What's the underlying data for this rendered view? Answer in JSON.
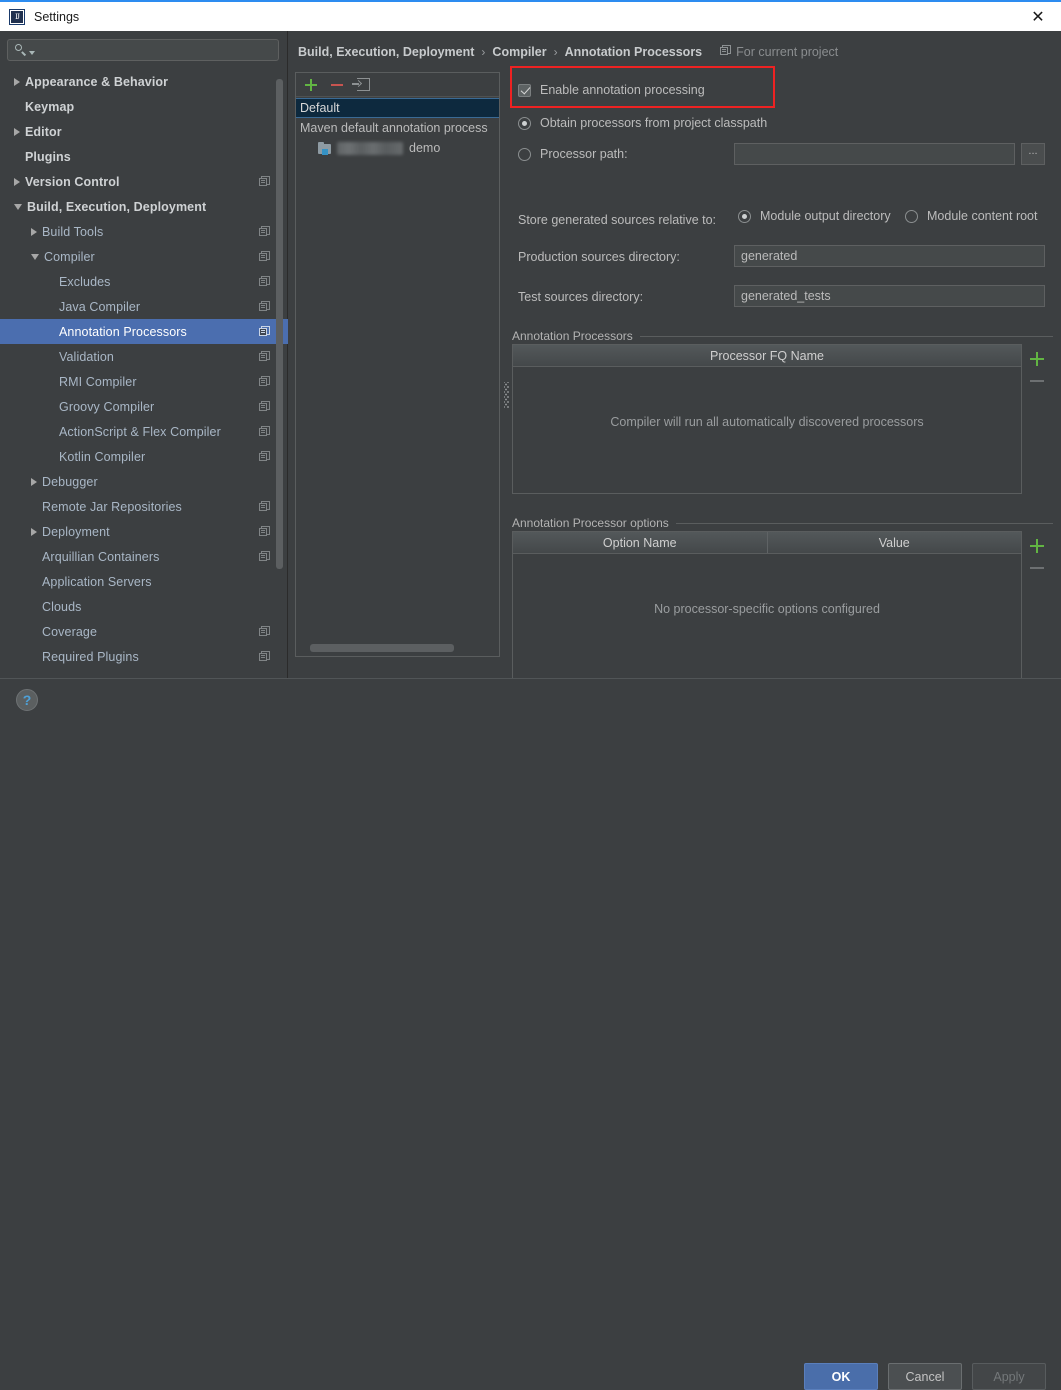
{
  "window": {
    "title": "Settings",
    "app_icon": "intellij-idea-icon",
    "close_label": "✕"
  },
  "sidebar": {
    "search": {
      "placeholder": "",
      "value": "",
      "icon": "search-icon"
    },
    "items": [
      {
        "label": "Appearance & Behavior",
        "indent": 0,
        "arrow": "collapsed",
        "bold": true,
        "project_icon": false,
        "selected": false
      },
      {
        "label": "Keymap",
        "indent": 0,
        "arrow": "none",
        "bold": true,
        "project_icon": false,
        "selected": false
      },
      {
        "label": "Editor",
        "indent": 0,
        "arrow": "collapsed",
        "bold": true,
        "project_icon": false,
        "selected": false
      },
      {
        "label": "Plugins",
        "indent": 0,
        "arrow": "none",
        "bold": true,
        "project_icon": false,
        "selected": false
      },
      {
        "label": "Version Control",
        "indent": 0,
        "arrow": "collapsed",
        "bold": true,
        "project_icon": true,
        "selected": false
      },
      {
        "label": "Build, Execution, Deployment",
        "indent": 0,
        "arrow": "expanded",
        "bold": true,
        "project_icon": false,
        "selected": false
      },
      {
        "label": "Build Tools",
        "indent": 1,
        "arrow": "collapsed",
        "bold": false,
        "project_icon": true,
        "selected": false
      },
      {
        "label": "Compiler",
        "indent": 1,
        "arrow": "expanded",
        "bold": false,
        "project_icon": true,
        "selected": false
      },
      {
        "label": "Excludes",
        "indent": 2,
        "arrow": "none",
        "bold": false,
        "project_icon": true,
        "selected": false
      },
      {
        "label": "Java Compiler",
        "indent": 2,
        "arrow": "none",
        "bold": false,
        "project_icon": true,
        "selected": false
      },
      {
        "label": "Annotation Processors",
        "indent": 2,
        "arrow": "none",
        "bold": false,
        "project_icon": true,
        "selected": true
      },
      {
        "label": "Validation",
        "indent": 2,
        "arrow": "none",
        "bold": false,
        "project_icon": true,
        "selected": false
      },
      {
        "label": "RMI Compiler",
        "indent": 2,
        "arrow": "none",
        "bold": false,
        "project_icon": true,
        "selected": false
      },
      {
        "label": "Groovy Compiler",
        "indent": 2,
        "arrow": "none",
        "bold": false,
        "project_icon": true,
        "selected": false
      },
      {
        "label": "ActionScript & Flex Compiler",
        "indent": 2,
        "arrow": "none",
        "bold": false,
        "project_icon": true,
        "selected": false
      },
      {
        "label": "Kotlin Compiler",
        "indent": 2,
        "arrow": "none",
        "bold": false,
        "project_icon": true,
        "selected": false
      },
      {
        "label": "Debugger",
        "indent": 1,
        "arrow": "collapsed",
        "bold": false,
        "project_icon": false,
        "selected": false
      },
      {
        "label": "Remote Jar Repositories",
        "indent": 1,
        "arrow": "none",
        "bold": false,
        "project_icon": true,
        "selected": false
      },
      {
        "label": "Deployment",
        "indent": 1,
        "arrow": "collapsed",
        "bold": false,
        "project_icon": true,
        "selected": false
      },
      {
        "label": "Arquillian Containers",
        "indent": 1,
        "arrow": "none",
        "bold": false,
        "project_icon": true,
        "selected": false
      },
      {
        "label": "Application Servers",
        "indent": 1,
        "arrow": "none",
        "bold": false,
        "project_icon": false,
        "selected": false
      },
      {
        "label": "Clouds",
        "indent": 1,
        "arrow": "none",
        "bold": false,
        "project_icon": false,
        "selected": false
      },
      {
        "label": "Coverage",
        "indent": 1,
        "arrow": "none",
        "bold": false,
        "project_icon": true,
        "selected": false
      },
      {
        "label": "Required Plugins",
        "indent": 1,
        "arrow": "none",
        "bold": false,
        "project_icon": true,
        "selected": false
      }
    ]
  },
  "breadcrumb": {
    "crumbs": [
      "Build, Execution, Deployment",
      "Compiler",
      "Annotation Processors"
    ],
    "separator": "›",
    "for_project_label": "For current project",
    "for_project_icon": "project-scope-icon"
  },
  "profiles": {
    "toolbar": {
      "add_label": "add-profile",
      "remove_label": "remove-profile",
      "move_label": "move-to-profile"
    },
    "items": [
      {
        "label": "Default",
        "selected": true,
        "icon": null,
        "blurred": false
      },
      {
        "label": "Maven default annotation process",
        "selected": false,
        "icon": null,
        "blurred": false
      },
      {
        "label": "demo",
        "selected": false,
        "icon": "module-folder-icon",
        "blurred": true
      }
    ]
  },
  "settings": {
    "enable_processing": {
      "label": "Enable annotation processing",
      "checked": true
    },
    "source_mode": {
      "obtain_from_classpath": {
        "label": "Obtain processors from project classpath",
        "selected": true
      },
      "processor_path": {
        "label": "Processor path:",
        "selected": false,
        "value": "",
        "browse_label": "..."
      }
    },
    "store_relative": {
      "label": "Store generated sources relative to:",
      "options": [
        {
          "label": "Module output directory",
          "selected": true
        },
        {
          "label": "Module content root",
          "selected": false
        }
      ]
    },
    "production_sources": {
      "label": "Production sources directory:",
      "value": "generated"
    },
    "test_sources": {
      "label": "Test sources directory:",
      "value": "generated_tests"
    },
    "processors_group": {
      "title": "Annotation Processors",
      "columns": [
        "Processor FQ Name"
      ],
      "rows": [],
      "empty_text": "Compiler will run all automatically discovered processors",
      "add_label": "add-processor",
      "remove_label": "remove-processor"
    },
    "options_group": {
      "title": "Annotation Processor options",
      "columns": [
        "Option Name",
        "Value"
      ],
      "rows": [],
      "empty_text": "No processor-specific options configured",
      "add_label": "add-option",
      "remove_label": "remove-option"
    }
  },
  "footer": {
    "help_label": "?",
    "ok_label": "OK",
    "cancel_label": "Cancel",
    "apply_label": "Apply"
  },
  "colors": {
    "accent_blue": "#4b6eaf",
    "selection_list": "#0d293e",
    "background": "#3c3f41",
    "highlight_red": "#ee2222",
    "add_green": "#62b543",
    "remove_red": "#c75450",
    "titlebar_blue": "#2d8cf0"
  }
}
